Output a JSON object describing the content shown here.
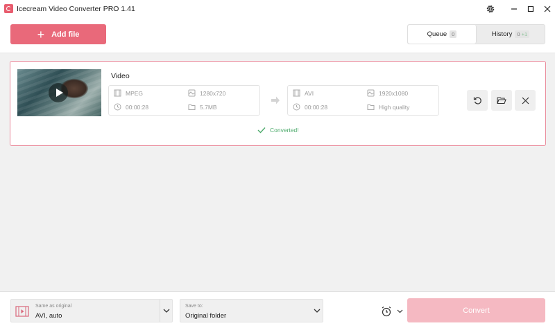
{
  "window": {
    "title": "Icecream Video Converter PRO 1.41"
  },
  "toolbar": {
    "add_file_label": "Add file",
    "tabs": [
      {
        "label": "Queue",
        "count": "0",
        "active": true
      },
      {
        "label": "History",
        "count": "0",
        "extra": "+1",
        "active": false
      }
    ]
  },
  "item": {
    "name": "Video",
    "source": {
      "format": "MPEG",
      "resolution": "1280x720",
      "duration": "00:00:28",
      "size": "5.7MB"
    },
    "target": {
      "format": "AVI",
      "resolution": "1920x1080",
      "duration": "00:00:28",
      "quality": "High quality"
    },
    "status": "Converted!"
  },
  "bottom": {
    "format_caption": "Same as original",
    "format_value": "AVI, auto",
    "save_caption": "Save to:",
    "save_value": "Original folder",
    "convert_label": "Convert"
  },
  "colors": {
    "accent": "#e9697a",
    "card_border": "#e9899a",
    "success": "#4caa6b",
    "convert_disabled": "#f5b9c2"
  }
}
